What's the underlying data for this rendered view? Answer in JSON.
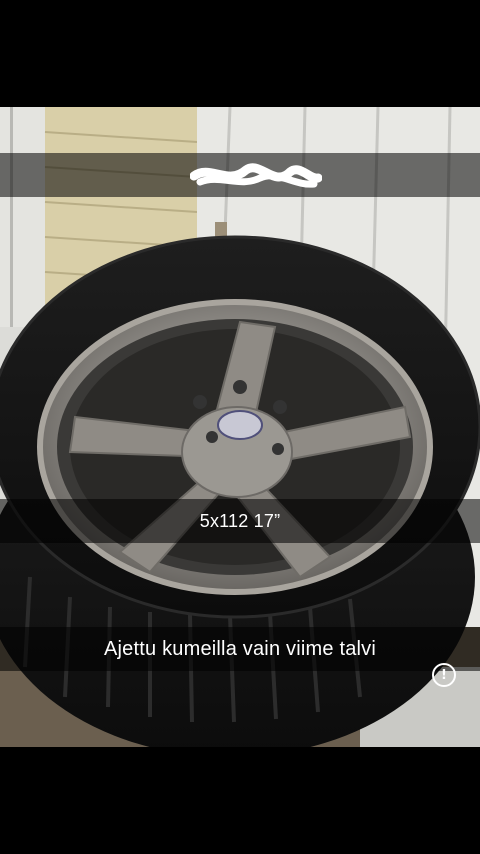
{
  "story": {
    "caption_top": "",
    "caption_middle": "5x112 17”",
    "caption_bottom": "Ajettu kumeilla vain viime talvi",
    "info_icon": "exclamation-circle-icon",
    "info_glyph": "!"
  },
  "colors": {
    "background": "#000000",
    "caption_bar": "rgba(0,0,0,0.55)",
    "caption_text": "#ffffff",
    "siding_white": "#e8e8e4",
    "siding_beige": "#d9cfa8",
    "rim_silver": "#8d8a85",
    "tire_black": "#141414"
  }
}
